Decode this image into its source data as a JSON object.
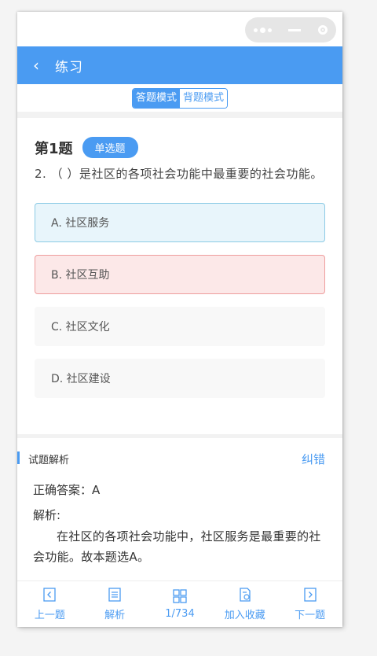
{
  "nav": {
    "back_icon": "‹",
    "title": "练习"
  },
  "mode": {
    "answer_label": "答题模式",
    "recite_label": "背题模式"
  },
  "question": {
    "number_label": "第1题",
    "type_tag": "单选题",
    "text": "2. （ ）是社区的各项社会功能中最重要的社会功能。",
    "options": [
      {
        "label": "A. 社区服务",
        "state": "correct"
      },
      {
        "label": "B. 社区互助",
        "state": "wrong"
      },
      {
        "label": "C. 社区文化",
        "state": "normal"
      },
      {
        "label": "D. 社区建设",
        "state": "normal"
      }
    ]
  },
  "analysis": {
    "title": "试题解析",
    "report_error": "纠错",
    "correct_answer": "正确答案：A",
    "explanation_label": "解析:",
    "explanation_text": "在社区的各项社会功能中，社区服务是最重要的社会功能。故本题选A。"
  },
  "tabbar": {
    "prev": "上一题",
    "analysis": "解析",
    "progress": "1/734",
    "favorite": "加入收藏",
    "next": "下一题"
  },
  "colors": {
    "primary": "#4a9bf2",
    "correct_bg": "#e8f5fb",
    "wrong_bg": "#fce8e8"
  }
}
